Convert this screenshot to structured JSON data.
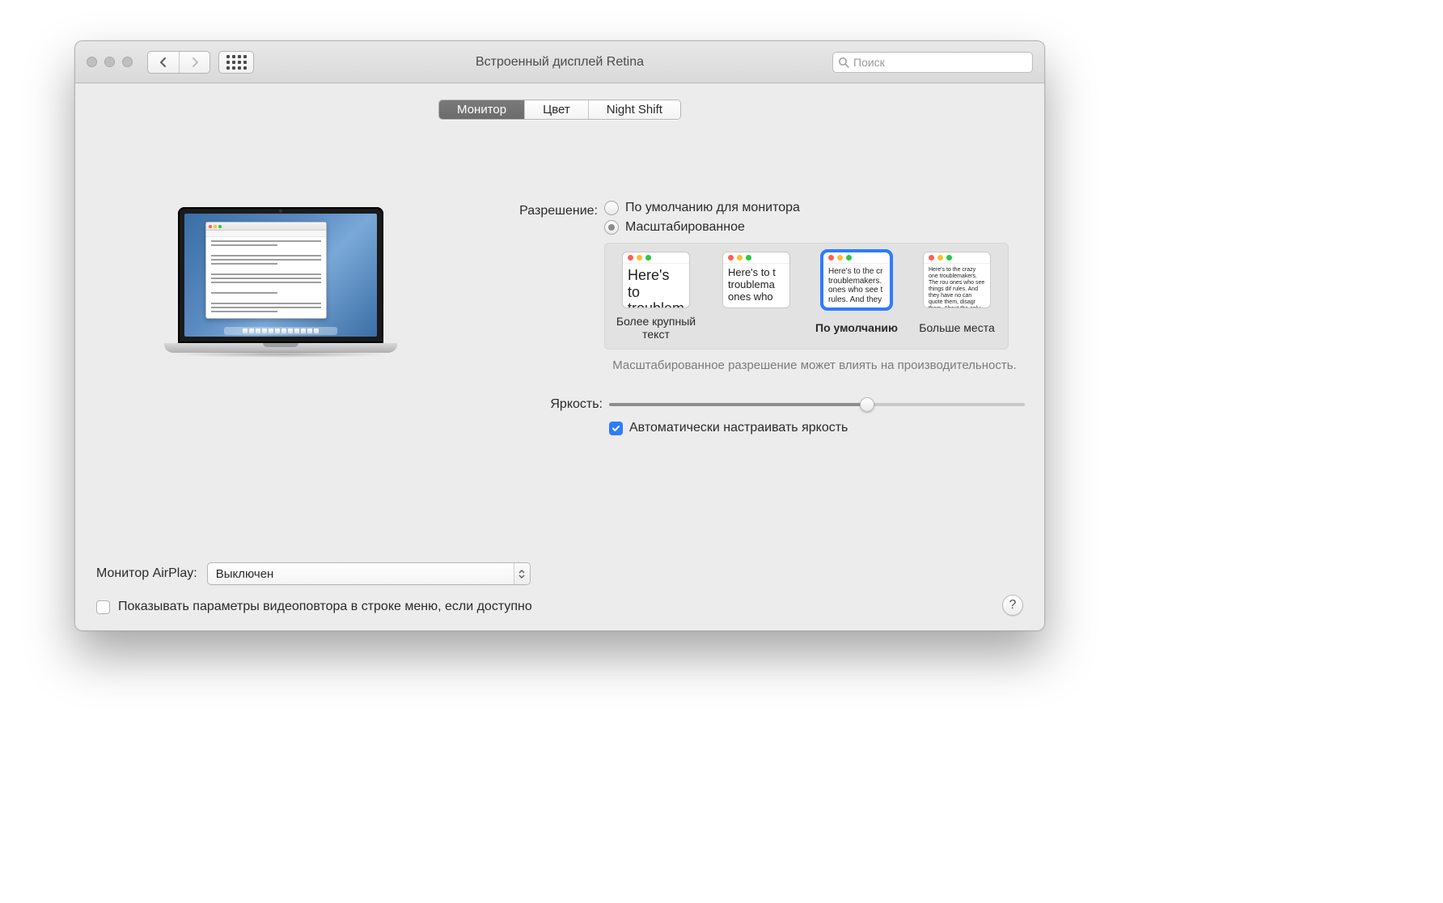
{
  "window": {
    "title": "Встроенный дисплей Retina"
  },
  "search": {
    "placeholder": "Поиск"
  },
  "tabs": {
    "monitor": "Монитор",
    "color": "Цвет",
    "nightshift": "Night Shift",
    "active": "monitor"
  },
  "resolution": {
    "label": "Разрешение:",
    "option_default": "По умолчанию для монитора",
    "option_scaled": "Масштабированное",
    "selected": "scaled"
  },
  "scaled": {
    "thumbs": [
      {
        "caption": "Более крупный текст",
        "sample": "Here's to troublem"
      },
      {
        "caption": "",
        "sample": "Here's to t troublema ones who"
      },
      {
        "caption": "По умолчанию",
        "sample": "Here's to the cr troublemakers. ones who see t rules. And they",
        "selected": true
      },
      {
        "caption": "Больше места",
        "sample": "Here's to the crazy one troublemakers. The rou ones who see things dif rules. And they have no can quote them, disagr them. About the only th Because they change th"
      }
    ],
    "hint": "Масштабированное разрешение может влиять на производительность."
  },
  "brightness": {
    "label": "Яркость:",
    "value": 62,
    "auto_label": "Автоматически настраивать яркость",
    "auto_checked": true
  },
  "airplay": {
    "label": "Монитор AirPlay:",
    "value": "Выключен"
  },
  "mirroring": {
    "label": "Показывать параметры видеоповтора в строке меню, если доступно",
    "checked": false
  },
  "help": "?"
}
